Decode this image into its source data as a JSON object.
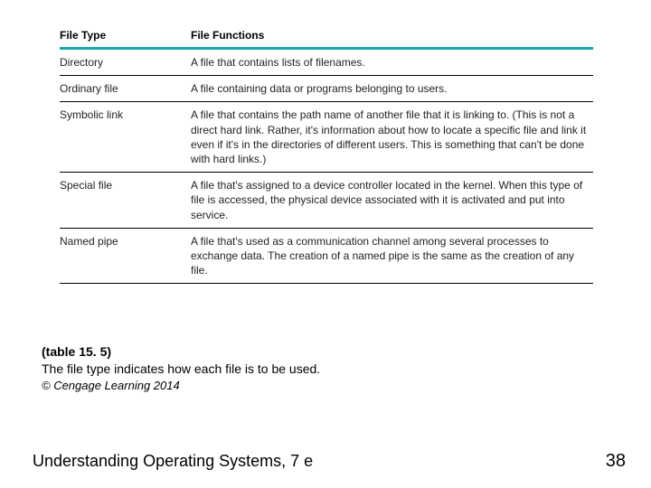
{
  "table": {
    "headers": {
      "col1": "File Type",
      "col2": "File Functions"
    },
    "rows": [
      {
        "type": "Directory",
        "func": "A file that contains lists of filenames."
      },
      {
        "type": "Ordinary file",
        "func": "A file containing data or programs belonging to users."
      },
      {
        "type": "Symbolic link",
        "func": "A file that contains the path name of another file that it is linking to. (This is not a direct hard link. Rather, it's information about how to locate a specific file and link it even if it's in the directories of different users. This is something that can't be done with hard links.)"
      },
      {
        "type": "Special file",
        "func": "A file that's assigned to a device controller located in the kernel. When this type of file is accessed, the physical device associated with it is activated and put into service."
      },
      {
        "type": "Named pipe",
        "func": "A file that's used as a communication channel among several processes to exchange data. The creation of a named pipe is the same as the creation of any file."
      }
    ]
  },
  "caption": {
    "label": "(table 15. 5)",
    "text": "The file type indicates how each file is to be used.",
    "copyright": "© Cengage Learning 2014"
  },
  "footer": {
    "book": "Understanding Operating Systems, 7 e",
    "page": "38"
  }
}
